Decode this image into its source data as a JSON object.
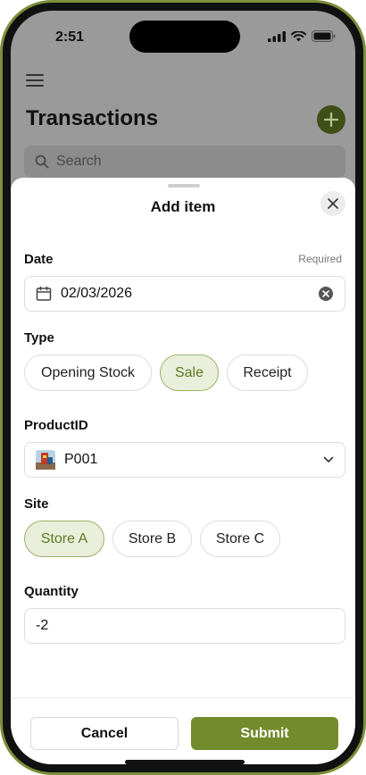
{
  "status_bar": {
    "time": "2:51"
  },
  "background": {
    "title": "Transactions",
    "search_placeholder": "Search"
  },
  "sheet": {
    "title": "Add item",
    "date": {
      "label": "Date",
      "required": "Required",
      "value": "02/03/2026"
    },
    "type": {
      "label": "Type",
      "options": [
        "Opening Stock",
        "Sale",
        "Receipt"
      ],
      "selected": "Sale"
    },
    "product": {
      "label": "ProductID",
      "value": "P001"
    },
    "site": {
      "label": "Site",
      "options": [
        "Store A",
        "Store B",
        "Store C"
      ],
      "selected": "Store A"
    },
    "quantity": {
      "label": "Quantity",
      "value": "-2"
    },
    "cancel_label": "Cancel",
    "submit_label": "Submit"
  },
  "colors": {
    "accent": "#748b2d",
    "chip_selected_bg": "#e9efdb",
    "chip_selected_text": "#5d7a25",
    "frame": "#7c8f3a"
  }
}
